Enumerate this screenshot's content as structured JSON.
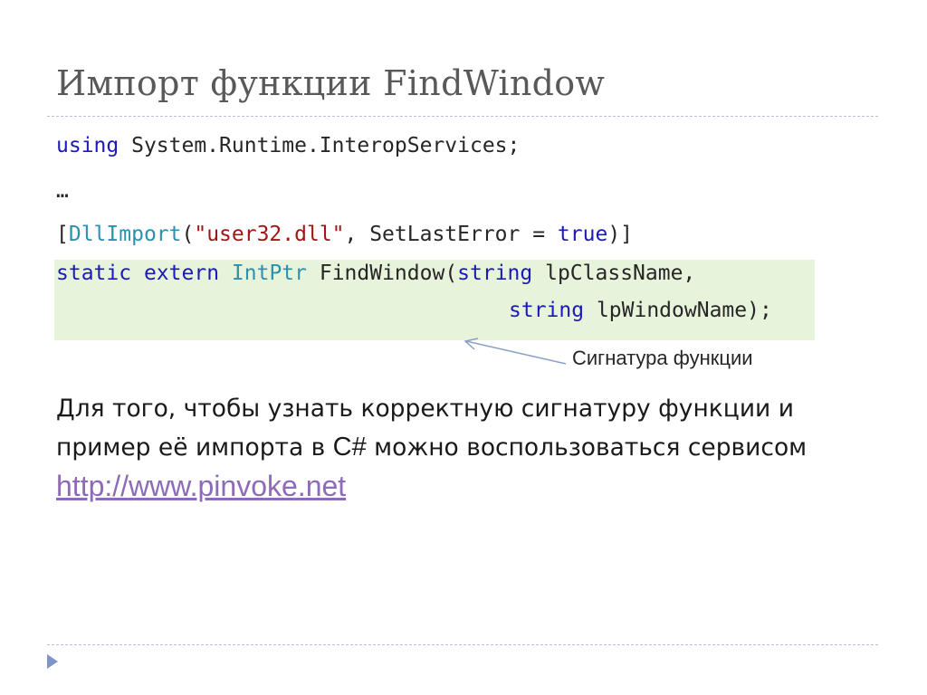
{
  "title": "Импорт функции FindWindow",
  "code": {
    "line1": {
      "keyword": "using",
      "rest": " System.Runtime.InteropServices;"
    },
    "line2": "…",
    "line3": {
      "open": "[",
      "attr": "DllImport",
      "paren": "(",
      "str": "\"user32.dll\"",
      "mid": ", SetLastError = ",
      "kw_true": "true",
      "close": ")]"
    },
    "line4": {
      "kw_static": "static",
      "kw_extern": "extern",
      "type": "IntPtr",
      "name": " FindWindow(",
      "kw_string": "string",
      "param": " lpClassName,"
    },
    "line5": {
      "kw_string": "string",
      "param": " lpWindowName);"
    }
  },
  "annotation": "Сигнатура функции",
  "paragraph": {
    "text1": "Для того, чтобы узнать корректную сигнатуру функции и пример её импорта в ",
    "cs": "C#",
    "text2": " можно воспользоваться сервисом ",
    "link": "http://www.pinvoke.net"
  },
  "colors": {
    "keyword": "#1c1ab8",
    "type": "#2b91af",
    "string": "#a31515",
    "highlight": "#e8f3dc",
    "link": "#8e6bb8",
    "title": "#595959"
  },
  "icons": [
    "bullet-triangle-icon",
    "arrow-icon"
  ]
}
